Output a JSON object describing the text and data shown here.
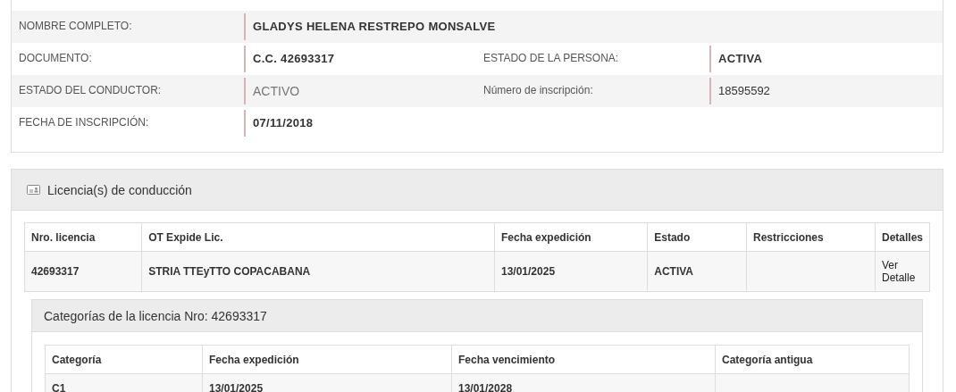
{
  "person": {
    "rows": [
      {
        "fields": [
          {
            "label": "NOMBRE COMPLETO:",
            "value": "GLADYS HELENA RESTREPO MONSALVE",
            "kind": "strong"
          }
        ]
      },
      {
        "fields": [
          {
            "label": "DOCUMENTO:",
            "value": "C.C. 42693317",
            "kind": "strong"
          },
          {
            "label": "ESTADO DE LA PERSONA:",
            "value": "ACTIVA",
            "kind": "strong"
          }
        ]
      },
      {
        "fields": [
          {
            "label": "ESTADO DEL CONDUCTOR:",
            "value": "ACTIVO",
            "kind": "muted"
          },
          {
            "label": "Número de inscripción:",
            "value": "18595592",
            "kind": "plain"
          }
        ]
      },
      {
        "fields": [
          {
            "label": "FECHA DE INSCRIPCIÓN:",
            "value": "07/11/2018",
            "kind": "strong"
          }
        ]
      }
    ]
  },
  "licenses": {
    "title": "Licencia(s) de conducción",
    "table": {
      "columns": [
        "Nro. licencia",
        "OT Expide Lic.",
        "Fecha expedición",
        "Estado",
        "Restricciones",
        "Detalles"
      ],
      "rows": [
        {
          "cells": [
            "42693317",
            "STRIA TTEyTTO COPACABANA",
            "13/01/2025",
            "ACTIVA",
            ""
          ],
          "link": "Ver Detalle"
        }
      ]
    },
    "categories": {
      "title": "Categorías de la licencia Nro: 42693317",
      "columns": [
        "Categoría",
        "Fecha expedición",
        "Fecha vencimiento",
        "Categoría antigua"
      ],
      "rows": [
        {
          "cells": [
            "C1",
            "13/01/2025",
            "13/01/2028",
            ""
          ]
        }
      ]
    }
  }
}
